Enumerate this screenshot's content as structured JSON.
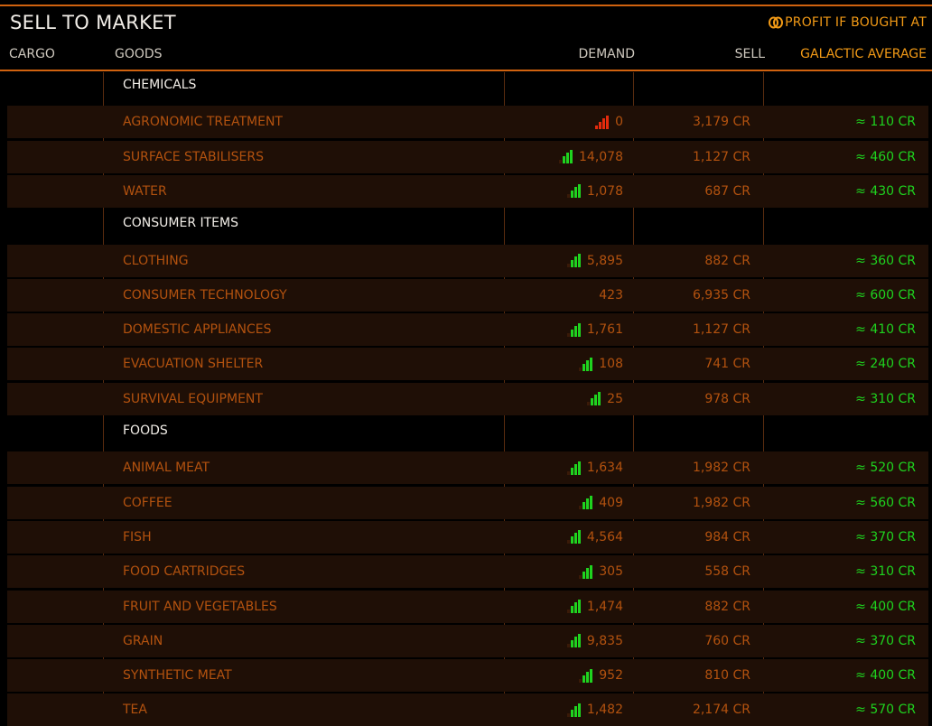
{
  "title": "SELL TO MARKET",
  "profit_label": "PROFIT IF BOUGHT AT",
  "columns": {
    "cargo": "CARGO",
    "goods": "GOODS",
    "demand": "DEMAND",
    "sell": "SELL",
    "galactic_average": "GALACTIC AVERAGE"
  },
  "colors": {
    "accent": "#d0620f",
    "item_text": "#b3520f",
    "highlight": "#f29a16",
    "demand_high": "#1fd31f",
    "demand_low": "#e42b0d"
  },
  "categories": [
    {
      "name": "CHEMICALS",
      "items": [
        {
          "name": "AGRONOMIC TREATMENT",
          "demand_icon": "red-bars-icon",
          "demand": "0",
          "sell": "3,179 CR",
          "avg": "≈ 110 CR"
        },
        {
          "name": "SURFACE STABILISERS",
          "demand_icon": "green-bars-icon",
          "demand": "14,078",
          "sell": "1,127 CR",
          "avg": "≈ 460 CR"
        },
        {
          "name": "WATER",
          "demand_icon": "green-bars-icon",
          "demand": "1,078",
          "sell": "687 CR",
          "avg": "≈ 430 CR"
        }
      ]
    },
    {
      "name": "CONSUMER ITEMS",
      "items": [
        {
          "name": "CLOTHING",
          "demand_icon": "green-bars-icon",
          "demand": "5,895",
          "sell": "882 CR",
          "avg": "≈ 360 CR"
        },
        {
          "name": "CONSUMER TECHNOLOGY",
          "demand_icon": "",
          "demand": "423",
          "sell": "6,935 CR",
          "avg": "≈ 600 CR"
        },
        {
          "name": "DOMESTIC APPLIANCES",
          "demand_icon": "green-bars-icon",
          "demand": "1,761",
          "sell": "1,127 CR",
          "avg": "≈ 410 CR"
        },
        {
          "name": "EVACUATION SHELTER",
          "demand_icon": "green-bars-icon",
          "demand": "108",
          "sell": "741 CR",
          "avg": "≈ 240 CR"
        },
        {
          "name": "SURVIVAL EQUIPMENT",
          "demand_icon": "green-bars-icon",
          "demand": "25",
          "sell": "978 CR",
          "avg": "≈ 310 CR"
        }
      ]
    },
    {
      "name": "FOODS",
      "items": [
        {
          "name": "ANIMAL MEAT",
          "demand_icon": "green-bars-icon",
          "demand": "1,634",
          "sell": "1,982 CR",
          "avg": "≈ 520 CR"
        },
        {
          "name": "COFFEE",
          "demand_icon": "green-bars-icon",
          "demand": "409",
          "sell": "1,982 CR",
          "avg": "≈ 560 CR"
        },
        {
          "name": "FISH",
          "demand_icon": "green-bars-icon",
          "demand": "4,564",
          "sell": "984 CR",
          "avg": "≈ 370 CR"
        },
        {
          "name": "FOOD CARTRIDGES",
          "demand_icon": "green-bars-icon",
          "demand": "305",
          "sell": "558 CR",
          "avg": "≈ 310 CR"
        },
        {
          "name": "FRUIT AND VEGETABLES",
          "demand_icon": "green-bars-icon",
          "demand": "1,474",
          "sell": "882 CR",
          "avg": "≈ 400 CR"
        },
        {
          "name": "GRAIN",
          "demand_icon": "green-bars-icon",
          "demand": "9,835",
          "sell": "760 CR",
          "avg": "≈ 370 CR"
        },
        {
          "name": "SYNTHETIC MEAT",
          "demand_icon": "green-bars-icon",
          "demand": "952",
          "sell": "810 CR",
          "avg": "≈ 400 CR"
        },
        {
          "name": "TEA",
          "demand_icon": "green-bars-icon",
          "demand": "1,482",
          "sell": "2,174 CR",
          "avg": "≈ 570 CR"
        }
      ]
    }
  ]
}
